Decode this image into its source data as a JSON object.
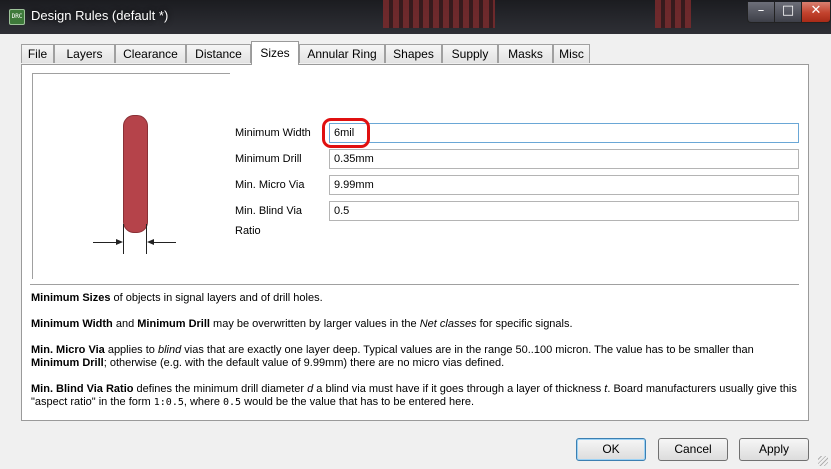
{
  "window": {
    "title": "Design Rules (default *)",
    "app_icon_text": "DRC",
    "minimize_glyph": "–",
    "maximize_glyph": "□",
    "close_glyph": "✕"
  },
  "tabs": [
    {
      "label": "File"
    },
    {
      "label": "Layers"
    },
    {
      "label": "Clearance"
    },
    {
      "label": "Distance"
    },
    {
      "label": "Sizes",
      "active": true
    },
    {
      "label": "Annular Ring"
    },
    {
      "label": "Shapes"
    },
    {
      "label": "Supply"
    },
    {
      "label": "Masks"
    },
    {
      "label": "Misc"
    }
  ],
  "fields": {
    "min_width": {
      "label": "Minimum Width",
      "value": "6mil"
    },
    "min_drill": {
      "label": "Minimum Drill",
      "value": "0.35mm"
    },
    "min_micro_via": {
      "label": "Min. Micro Via",
      "value": "9.99mm"
    },
    "min_blind_via_ratio": {
      "label": "Min. Blind Via Ratio",
      "value": "0.5"
    }
  },
  "help": {
    "p1": {
      "b1": "Minimum Sizes",
      "t1": " of objects in signal layers and of drill holes."
    },
    "p2": {
      "b1": "Minimum Width",
      "t1": " and ",
      "b2": "Minimum Drill",
      "t2": " may be overwritten by larger values in the ",
      "i1": "Net classes",
      "t3": " for specific signals."
    },
    "p3": {
      "b1": "Min. Micro Via",
      "t1": " applies to ",
      "i1": "blind",
      "t2": " vias that are exactly one layer deep. Typical values are in the range 50..100 micron. The value has to be smaller than ",
      "b2": "Minimum Drill",
      "t3": "; otherwise (e.g. with the default value of 9.99mm) there are no micro vias defined."
    },
    "p4": {
      "b1": "Min. Blind Via Ratio",
      "t1": " defines the minimum drill diameter ",
      "i1": "d",
      "t2": " a blind via must have if it goes through a layer of thickness ",
      "i2": "t",
      "t3": ". Board manufacturers usually give this \"aspect ratio\" in the form ",
      "m1": "1:0.5",
      "t4": ", where ",
      "m2": "0.5",
      "t5": " would be the value that has to be entered here."
    }
  },
  "buttons": {
    "ok": "OK",
    "cancel": "Cancel",
    "apply": "Apply"
  },
  "colors": {
    "track": "#b5434a",
    "highlight_ring": "#e01010"
  }
}
